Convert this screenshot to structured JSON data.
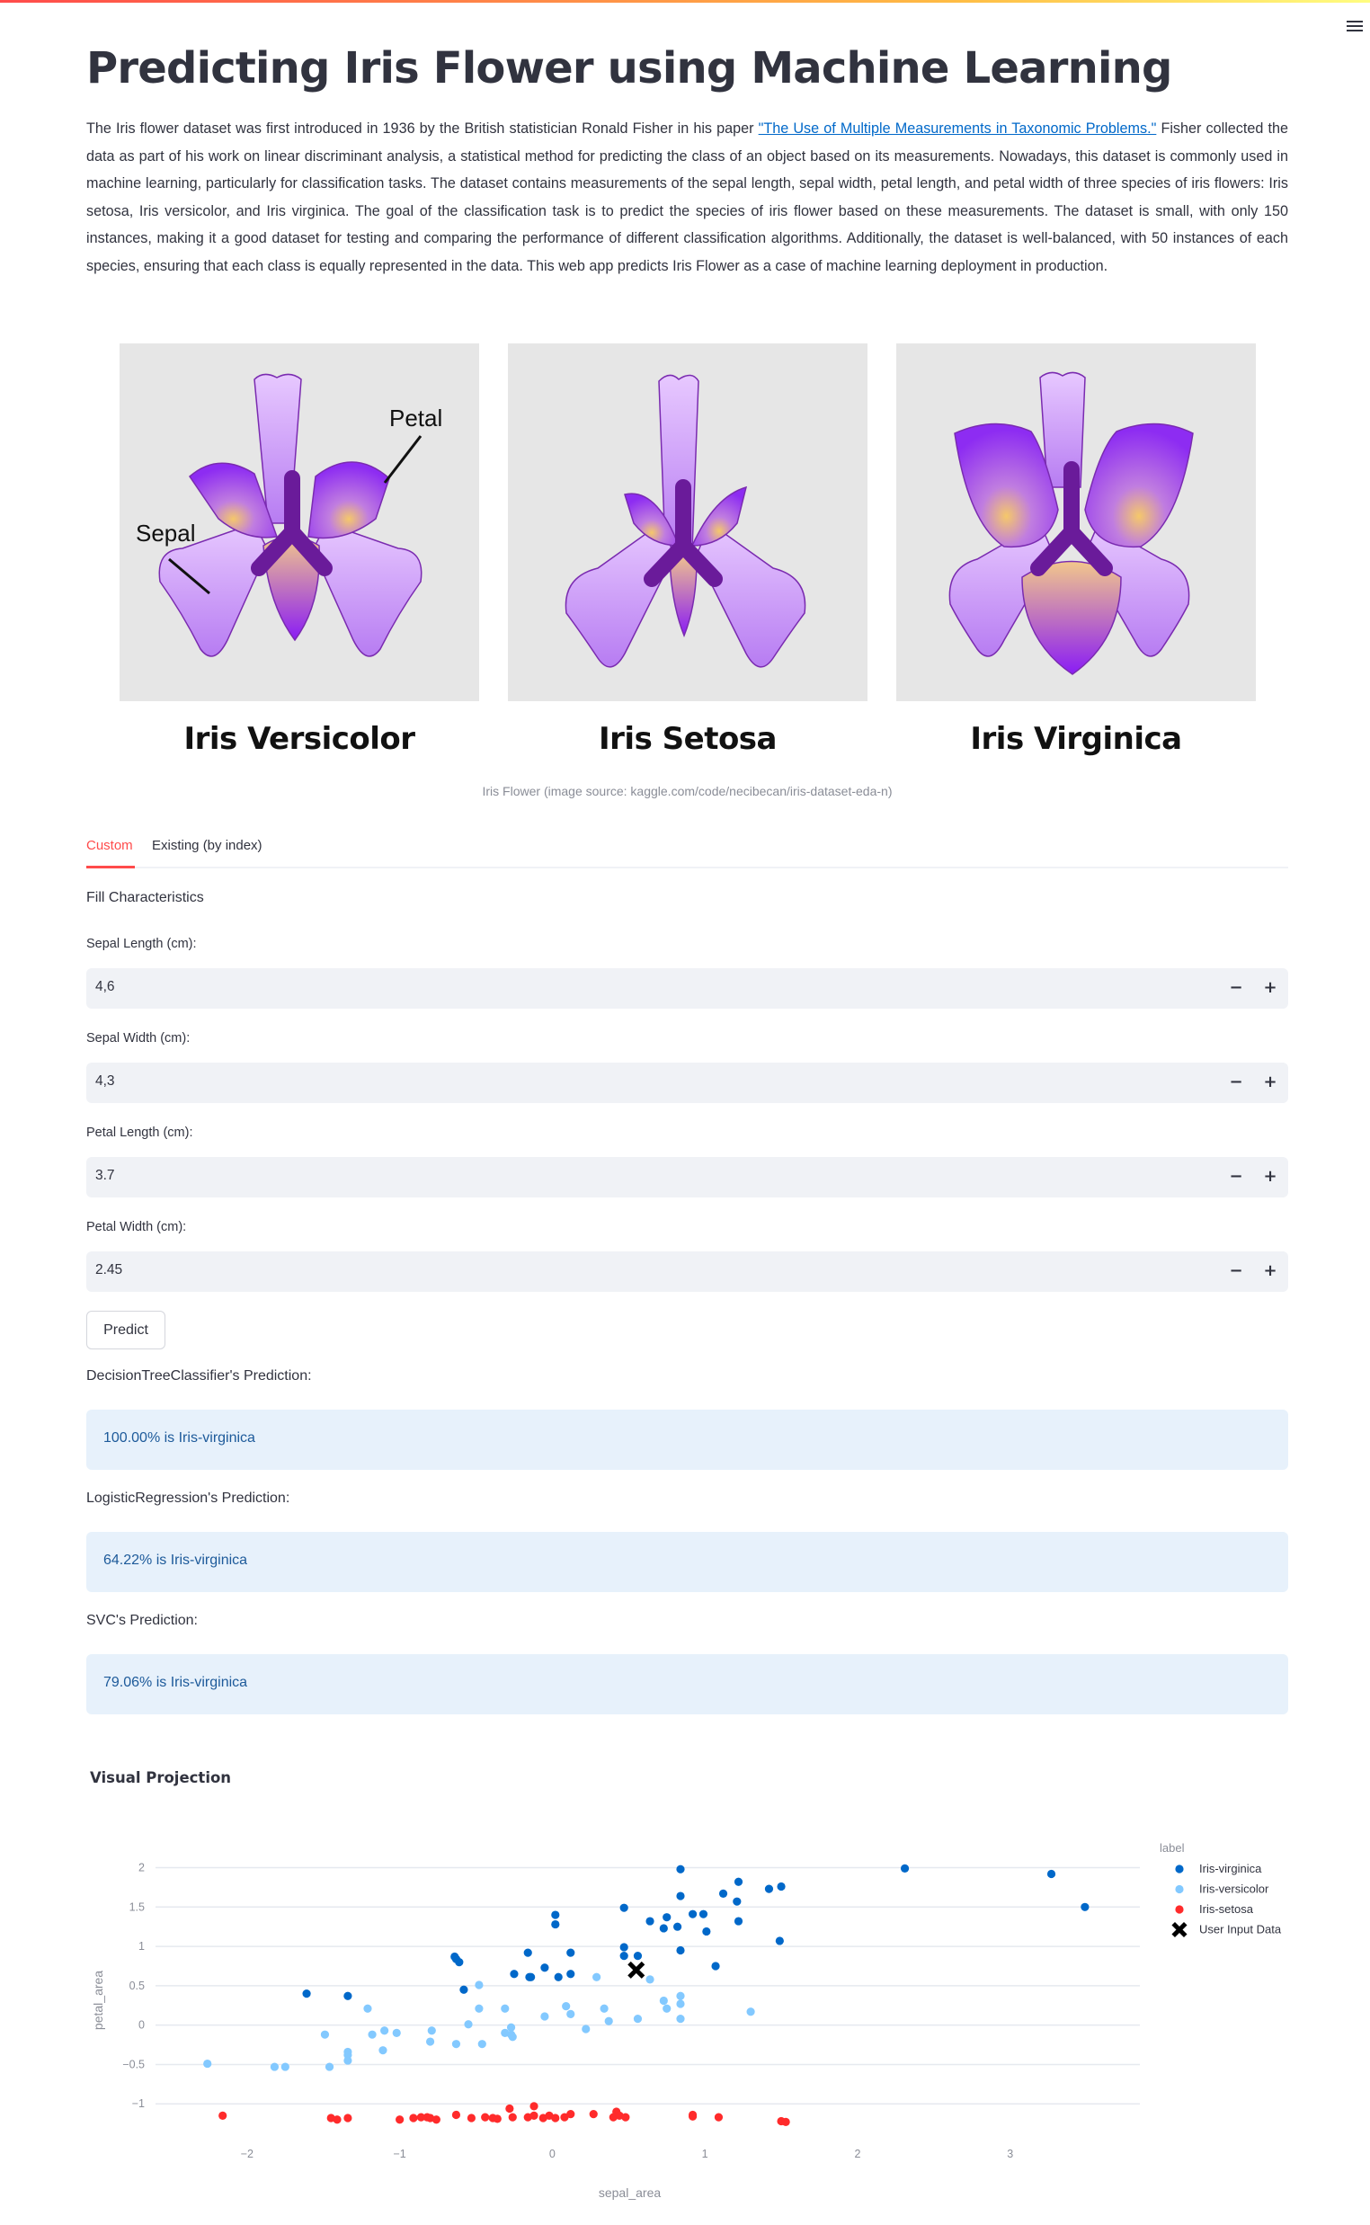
{
  "header": {
    "menu_icon": "hamburger-menu-icon"
  },
  "page": {
    "title": "Predicting Iris Flower using Machine Learning",
    "intro_before_link": "The Iris flower dataset was first introduced in 1936 by the British statistician Ronald Fisher in his paper ",
    "intro_link": "\"The Use of Multiple Measurements in Taxonomic Problems.\"",
    "intro_after_link": " Fisher collected the data as part of his work on linear discriminant analysis, a statistical method for predicting the class of an object based on its measurements. Nowadays, this dataset is commonly used in machine learning, particularly for classification tasks. The dataset contains measurements of the sepal length, sepal width, petal length, and petal width of three species of iris flowers: Iris setosa, Iris versicolor, and Iris virginica. The goal of the classification task is to predict the species of iris flower based on these measurements. The dataset is small, with only 150 instances, making it a good dataset for testing and comparing the performance of different classification algorithms. Additionally, the dataset is well-balanced, with 50 instances of each species, ensuring that each class is equally represented in the data. This web app predicts Iris Flower as a case of machine learning deployment in production."
  },
  "figure": {
    "flowers": [
      {
        "name": "Iris Versicolor",
        "annotations": [
          "Petal",
          "Sepal"
        ]
      },
      {
        "name": "Iris Setosa"
      },
      {
        "name": "Iris Virginica"
      }
    ],
    "caption": "Iris Flower (image source: kaggle.com/code/necibecan/iris-dataset-eda-n)"
  },
  "tabs": [
    {
      "label": "Custom",
      "active": true
    },
    {
      "label": "Existing (by index)",
      "active": false
    }
  ],
  "form": {
    "subheading": "Fill Characteristics",
    "fields": [
      {
        "label": "Sepal Length (cm):",
        "value": "4,6"
      },
      {
        "label": "Sepal Width (cm):",
        "value": "4,3"
      },
      {
        "label": "Petal Length (cm):",
        "value": "3.7"
      },
      {
        "label": "Petal Width (cm):",
        "value": "2.45"
      }
    ],
    "decrement_symbol": "−",
    "increment_symbol": "+",
    "predict_label": "Predict"
  },
  "predictions": [
    {
      "model_label": "DecisionTreeClassifier's Prediction:",
      "result": "100.00% is Iris-virginica"
    },
    {
      "model_label": "LogisticRegression's Prediction:",
      "result": "64.22% is Iris-virginica"
    },
    {
      "model_label": "SVC's Prediction:",
      "result": "79.06% is Iris-virginica"
    }
  ],
  "visual_projection": {
    "title": "Visual Projection"
  },
  "chart_data": {
    "type": "scatter",
    "title": "",
    "xlabel": "sepal_area",
    "ylabel": "petal_area",
    "xlim": [
      -2.6,
      3.85
    ],
    "ylim": [
      -1.34,
      2.2
    ],
    "xticks": [
      -2,
      -1,
      0,
      1,
      2,
      3
    ],
    "yticks": [
      -1,
      -0.5,
      0,
      0.5,
      1,
      1.5,
      2
    ],
    "ytick_labels": [
      "−1",
      "−0.5",
      "0",
      "0.5",
      "1",
      "1.5",
      "2"
    ],
    "xtick_labels": [
      "−2",
      "−1",
      "0",
      "1",
      "2",
      "3"
    ],
    "grid": true,
    "legend_title": "label",
    "legend_position": "right",
    "series": [
      {
        "name": "Iris-virginica",
        "color": "#0068c9",
        "marker": "circle",
        "points": [
          [
            -1.61,
            0.4
          ],
          [
            -1.34,
            0.37
          ],
          [
            -0.64,
            0.87
          ],
          [
            -0.63,
            0.84
          ],
          [
            -0.61,
            0.8
          ],
          [
            -0.58,
            0.45
          ],
          [
            -0.25,
            0.65
          ],
          [
            -0.16,
            0.92
          ],
          [
            -0.15,
            0.61
          ],
          [
            -0.14,
            0.61
          ],
          [
            -0.05,
            0.73
          ],
          [
            0.02,
            1.4
          ],
          [
            0.02,
            1.28
          ],
          [
            0.04,
            0.61
          ],
          [
            0.12,
            0.65
          ],
          [
            0.12,
            0.92
          ],
          [
            0.47,
            1.49
          ],
          [
            0.47,
            0.99
          ],
          [
            0.47,
            0.88
          ],
          [
            0.56,
            0.88
          ],
          [
            0.64,
            1.32
          ],
          [
            0.73,
            1.23
          ],
          [
            0.75,
            1.37
          ],
          [
            0.82,
            1.25
          ],
          [
            0.84,
            1.98
          ],
          [
            0.84,
            1.64
          ],
          [
            0.84,
            0.95
          ],
          [
            0.92,
            1.41
          ],
          [
            0.99,
            1.41
          ],
          [
            1.01,
            1.19
          ],
          [
            1.07,
            0.75
          ],
          [
            1.12,
            1.67
          ],
          [
            1.21,
            1.57
          ],
          [
            1.22,
            1.82
          ],
          [
            1.22,
            1.32
          ],
          [
            1.42,
            1.73
          ],
          [
            1.49,
            1.07
          ],
          [
            1.5,
            1.76
          ],
          [
            2.31,
            1.99
          ],
          [
            3.27,
            1.92
          ],
          [
            3.49,
            1.5
          ]
        ]
      },
      {
        "name": "Iris-versicolor",
        "color": "#83c9ff",
        "marker": "circle",
        "points": [
          [
            -2.26,
            -0.49
          ],
          [
            -1.82,
            -0.53
          ],
          [
            -1.75,
            -0.53
          ],
          [
            -1.49,
            -0.12
          ],
          [
            -1.46,
            -0.53
          ],
          [
            -1.34,
            -0.34
          ],
          [
            -1.34,
            -0.38
          ],
          [
            -1.34,
            -0.45
          ],
          [
            -1.21,
            0.21
          ],
          [
            -1.18,
            -0.12
          ],
          [
            -1.11,
            -0.32
          ],
          [
            -1.1,
            -0.07
          ],
          [
            -1.02,
            -0.1
          ],
          [
            -0.8,
            -0.21
          ],
          [
            -0.79,
            -0.07
          ],
          [
            -0.63,
            -0.24
          ],
          [
            -0.55,
            0.01
          ],
          [
            -0.48,
            0.51
          ],
          [
            -0.48,
            0.21
          ],
          [
            -0.46,
            -0.24
          ],
          [
            -0.31,
            0.21
          ],
          [
            -0.31,
            -0.1
          ],
          [
            -0.27,
            -0.03
          ],
          [
            -0.27,
            -0.12
          ],
          [
            -0.26,
            -0.15
          ],
          [
            -0.05,
            0.11
          ],
          [
            0.09,
            0.24
          ],
          [
            0.12,
            0.14
          ],
          [
            0.22,
            -0.05
          ],
          [
            0.29,
            0.61
          ],
          [
            0.34,
            0.21
          ],
          [
            0.37,
            0.05
          ],
          [
            0.56,
            0.08
          ],
          [
            0.64,
            0.58
          ],
          [
            0.73,
            0.31
          ],
          [
            0.75,
            0.21
          ],
          [
            0.84,
            0.37
          ],
          [
            0.84,
            0.27
          ],
          [
            0.84,
            0.08
          ],
          [
            1.3,
            0.17
          ]
        ]
      },
      {
        "name": "Iris-setosa",
        "color": "#ff2b2b",
        "marker": "circle",
        "points": [
          [
            -2.16,
            -1.15
          ],
          [
            -1.45,
            -1.18
          ],
          [
            -1.41,
            -1.2
          ],
          [
            -1.34,
            -1.18
          ],
          [
            -1.0,
            -1.2
          ],
          [
            -0.91,
            -1.18
          ],
          [
            -0.86,
            -1.17
          ],
          [
            -0.82,
            -1.17
          ],
          [
            -0.8,
            -1.18
          ],
          [
            -0.76,
            -1.2
          ],
          [
            -0.63,
            -1.14
          ],
          [
            -0.53,
            -1.18
          ],
          [
            -0.44,
            -1.17
          ],
          [
            -0.39,
            -1.18
          ],
          [
            -0.36,
            -1.19
          ],
          [
            -0.28,
            -1.06
          ],
          [
            -0.26,
            -1.17
          ],
          [
            -0.16,
            -1.17
          ],
          [
            -0.12,
            -1.03
          ],
          [
            -0.12,
            -1.15
          ],
          [
            -0.06,
            -1.18
          ],
          [
            -0.02,
            -1.15
          ],
          [
            0.02,
            -1.18
          ],
          [
            0.08,
            -1.17
          ],
          [
            0.12,
            -1.13
          ],
          [
            0.27,
            -1.13
          ],
          [
            0.4,
            -1.17
          ],
          [
            0.42,
            -1.1
          ],
          [
            0.44,
            -1.15
          ],
          [
            0.48,
            -1.17
          ],
          [
            0.92,
            -1.14
          ],
          [
            0.92,
            -1.16
          ],
          [
            1.09,
            -1.17
          ],
          [
            1.5,
            -1.22
          ],
          [
            1.53,
            -1.23
          ]
        ]
      },
      {
        "name": "User Input Data",
        "color": "#000000",
        "marker": "x",
        "points": [
          [
            0.55,
            0.7
          ]
        ]
      }
    ]
  }
}
